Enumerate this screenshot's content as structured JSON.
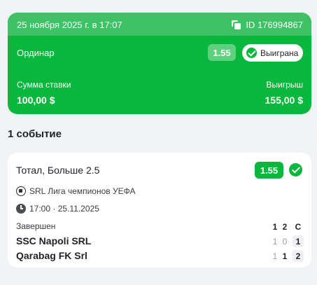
{
  "bet": {
    "date": "25 ноября 2025 г. в 17:07",
    "id": "ID 176994867",
    "type": "Ординар",
    "odds": "1.55",
    "status": "Выиграна",
    "stake_label": "Сумма ставки",
    "stake_value": "100,00 $",
    "win_label": "Выигрыш",
    "win_value": "155,00 $"
  },
  "events_count": "1 событие",
  "event": {
    "market": "Тотал, Больше 2.5",
    "odds": "1.55",
    "league": "SRL Лига чемпионов УЕФА",
    "datetime": "17:00 · 25.11.2025",
    "status": "Завершен",
    "columns": [
      "1",
      "2",
      "С"
    ],
    "teams": [
      {
        "name": "SSC Napoli SRL",
        "scores": [
          "1",
          "0",
          "1"
        ]
      },
      {
        "name": "Qarabag FK Srl",
        "scores": [
          "1",
          "1",
          "2"
        ]
      }
    ]
  },
  "colors": {
    "accent": "#08b73c",
    "header": "#3fc166",
    "background": "#f2f3f5"
  }
}
